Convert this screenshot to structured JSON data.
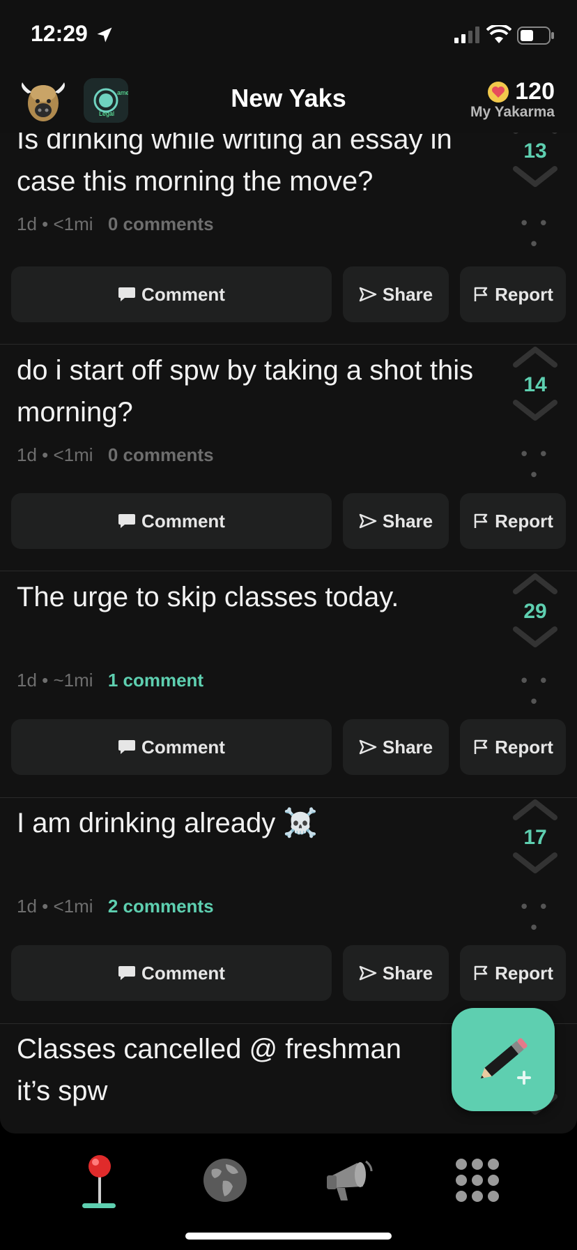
{
  "status_bar": {
    "time": "12:29"
  },
  "header": {
    "title": "New Yaks",
    "yakarma_value": "120",
    "yakarma_label": "My Yakarma",
    "herd_badge_text_1": "ame",
    "herd_badge_text_2": "Legal"
  },
  "posts": [
    {
      "text": "Is drinking while writing an essay in case this morning the move?",
      "age": "1d",
      "distance": "<1mi",
      "comments": "0 comments",
      "votes": "13"
    },
    {
      "text": "do i start off spw by taking a shot this morning?",
      "age": "1d",
      "distance": "<1mi",
      "comments": "0 comments",
      "votes": "14"
    },
    {
      "text": "The urge to skip classes today.",
      "age": "1d",
      "distance": "~1mi",
      "comments": "1 comment",
      "votes": "29"
    },
    {
      "text": "I am drinking already ☠️",
      "age": "1d",
      "distance": "<1mi",
      "comments": "2 comments",
      "votes": "17"
    },
    {
      "text": "Classes cancelled @ freshman it’s spw"
    }
  ],
  "actions": {
    "comment": "Comment",
    "share": "Share",
    "report": "Report"
  },
  "meta_separator": "•",
  "more_dots": "• • •",
  "colors": {
    "accent": "#5ecfb0",
    "background": "#121212",
    "button": "#1f2020"
  }
}
